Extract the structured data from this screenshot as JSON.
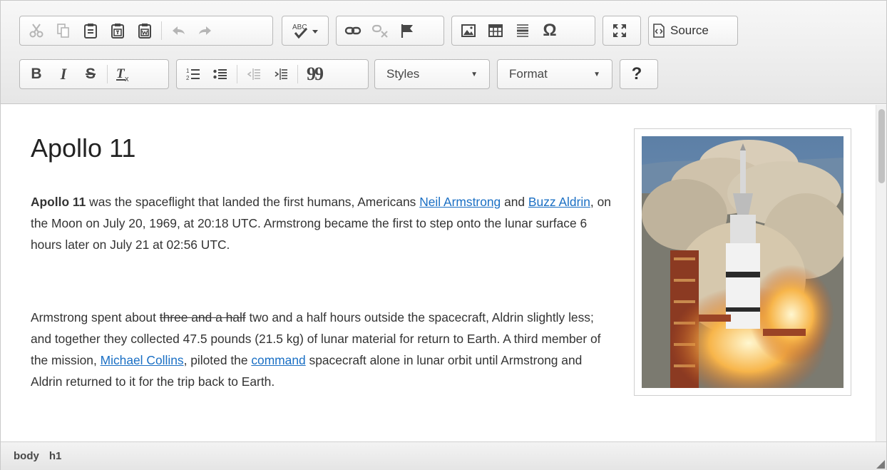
{
  "toolbar": {
    "row1": {
      "clipboard": [
        "cut-icon",
        "copy-icon",
        "paste-icon",
        "paste-text-icon",
        "paste-from-word-icon",
        "undo-icon",
        "redo-icon"
      ],
      "spellcheck_label": "ABC",
      "source_label": "Source"
    },
    "row2": {
      "bold": "B",
      "italic": "I",
      "strike": "S",
      "remove_format": "Tx",
      "blockquote": "99",
      "styles_label": "Styles",
      "format_label": "Format",
      "help_label": "?"
    }
  },
  "content": {
    "title": "Apollo 11",
    "p1": {
      "bold_lead": "Apollo 11",
      "t1": " was the spaceflight that landed the first humans, Americans ",
      "link_neil": "Neil Armstrong",
      "t2": " and ",
      "link_buzz": "Buzz Aldrin",
      "t3": ", on the Moon on July 20, 1969, at 20:18 UTC. Armstrong became the first to step onto the lunar surface 6 hours later on July 21 at 02:56 UTC."
    },
    "p2": {
      "t1": "Armstrong spent about ",
      "struck": "three and a half",
      "t2": " two and a half hours outside the spacecraft, Aldrin slightly less; and together they collected 47.5 pounds (21.5 kg) of lunar material for return to Earth. A third member of the mission, ",
      "link_collins": "Michael Collins",
      "t3": ", piloted the ",
      "link_command": "command",
      "t4": " spacecraft alone in lunar orbit until Armstrong and Aldrin returned to it for the trip back to Earth."
    },
    "image_subject": "rocket-launch-photo"
  },
  "statusbar": {
    "path": [
      "body",
      "h1"
    ]
  },
  "colors": {
    "link": "#1a6fc4",
    "toolbar_bg": "#ececec",
    "icon": "#474747",
    "icon_disabled": "#b5b5b5"
  }
}
